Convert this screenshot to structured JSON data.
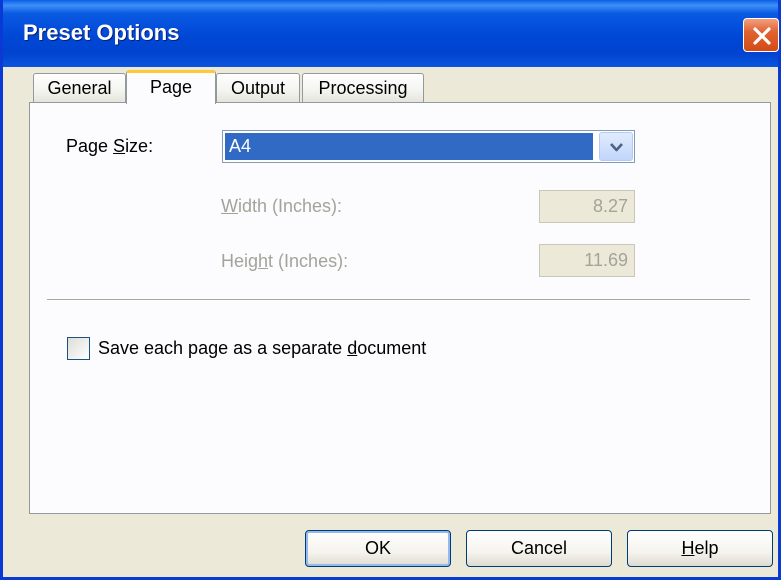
{
  "window": {
    "title": "Preset Options"
  },
  "tabs": [
    {
      "label": "General",
      "active": false
    },
    {
      "label": "Page",
      "active": true
    },
    {
      "label": "Output",
      "active": false
    },
    {
      "label": "Processing",
      "active": false
    }
  ],
  "page_tab": {
    "page_size": {
      "label_before": "Page ",
      "label_mnemonic": "S",
      "label_after": "ize:",
      "value": "A4"
    },
    "width": {
      "label_mnemonic": "W",
      "label_rest": "idth (Inches):",
      "value": "8.27",
      "enabled": false
    },
    "height": {
      "label_before": "Heig",
      "label_mnemonic": "h",
      "label_after": "t (Inches):",
      "value": "11.69",
      "enabled": false
    },
    "separate_document": {
      "label_before": "Save each page as a separate ",
      "label_mnemonic": "d",
      "label_after": "ocument",
      "checked": false
    }
  },
  "buttons": {
    "ok": "OK",
    "cancel": "Cancel",
    "help_mnemonic": "H",
    "help_rest": "elp"
  },
  "colors": {
    "title_bar": "#0047d6",
    "close_button": "#e2622f",
    "selection": "#316ac5",
    "active_tab_accent": "#ffc83c",
    "disabled_text": "#a4a39a"
  },
  "icons": {
    "close": "close-icon",
    "dropdown": "chevron-down-icon"
  }
}
